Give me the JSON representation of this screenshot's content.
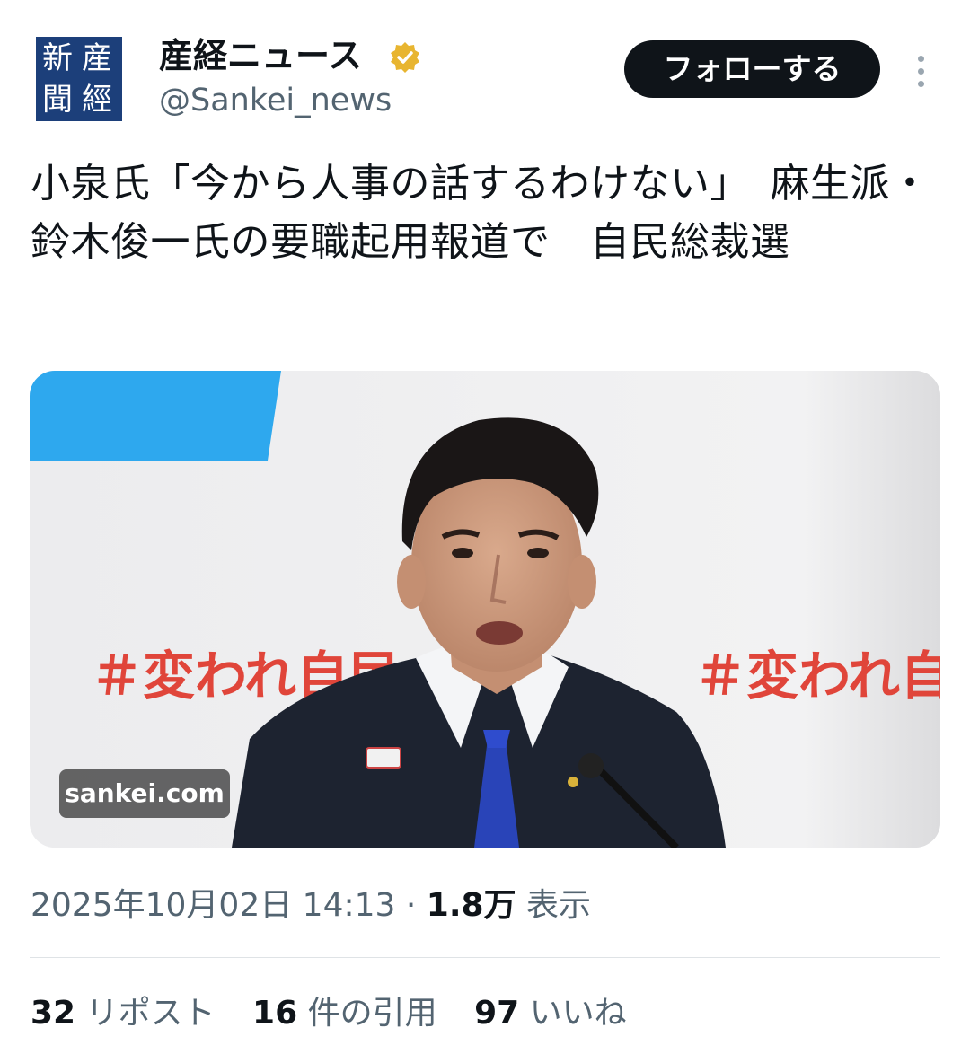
{
  "account": {
    "avatar_chars": [
      "産",
      "經",
      "新",
      "聞"
    ],
    "display_name": "産経ニュース",
    "handle": "@Sankei_news",
    "verified_icon": "verified-badge-gold"
  },
  "actions": {
    "follow_label": "フォローする",
    "more_icon": "more-vertical-icon"
  },
  "post": {
    "text": "小泉氏「今から人事の話するわけない」　麻生派・鈴木俊一氏の要職起用報道で　自民総裁選",
    "media": {
      "source_label": "sankei.com",
      "banner_text": "＃変われ自民"
    },
    "timestamp": "2025年10月02日 14:13",
    "separator": "·",
    "views_count": "1.8万",
    "views_label": "表示"
  },
  "stats": {
    "reposts": {
      "count": "32",
      "label": "リポスト"
    },
    "quotes": {
      "count": "16",
      "label": "件の引用"
    },
    "likes": {
      "count": "97",
      "label": "いいね"
    }
  },
  "colors": {
    "text": "#0f1419",
    "secondary": "#536471",
    "avatar_bg": "#1c3f7a",
    "verified": "#e8b530",
    "banner_red": "#e0453a"
  }
}
